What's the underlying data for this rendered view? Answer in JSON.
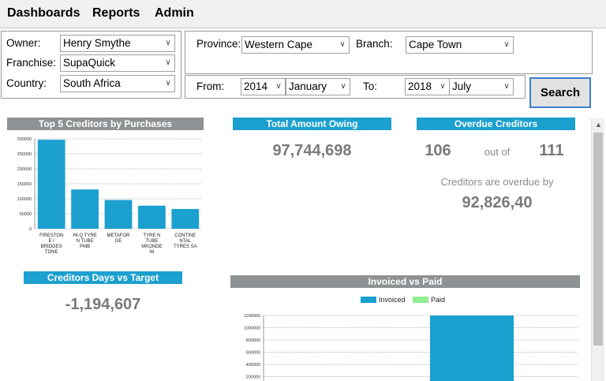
{
  "menu": {
    "items": [
      "Dashboards",
      "Reports",
      "Admin"
    ]
  },
  "filters": {
    "owner_label": "Owner:",
    "owner_value": "Henry Smythe",
    "franchise_label": "Franchise:",
    "franchise_value": "SupaQuick",
    "country_label": "Country:",
    "country_value": "South Africa",
    "province_label": "Province:",
    "province_value": "Western Cape",
    "branch_label": "Branch:",
    "branch_value": "Cape Town",
    "from_label": "From:",
    "from_year": "2014",
    "from_month": "January",
    "to_label": "To:",
    "to_year": "2018",
    "to_month": "July",
    "search_label": "Search"
  },
  "top_creditors": {
    "title": "Top 5 Creditors by Purchases"
  },
  "total_owing": {
    "title": "Total Amount Owing",
    "value": "97,744,698"
  },
  "overdue": {
    "title": "Overdue Creditors",
    "count": "106",
    "out_of": "out of",
    "total": "111",
    "overdue_by_label": "Creditors are overdue by",
    "overdue_by_value": "92,826,40"
  },
  "creditor_days": {
    "title": "Creditors Days vs Target",
    "value": "-1,194,607"
  },
  "invoiced_vs_paid": {
    "title": "Invoiced vs Paid"
  },
  "colors": {
    "accent_blue": "#1ba0cf",
    "title_gray": "#8e9295",
    "paid_green": "#90ee90"
  },
  "chart_data": [
    {
      "type": "bar",
      "title": "Top 5 Creditors by Purchases",
      "categories": [
        "FIRESTON E / BRIDGES TONE",
        "HI-Q TYRE N TUBE PMB",
        "METAFOR GE",
        "TYRE N TUBE MKONDE NI",
        "CONTINE NTAL TYRES SA"
      ],
      "category_lines": [
        [
          "FIRESTON",
          "E /",
          "BRIDGES",
          "TONE"
        ],
        [
          "HI-Q TYRE",
          "N TUBE",
          "PMB"
        ],
        [
          "METAFOR",
          "GE"
        ],
        [
          "TYRE N",
          "TUBE",
          "MKONDE",
          "NI"
        ],
        [
          "CONTINE",
          "NTAL",
          "TYRES SA"
        ]
      ],
      "values": [
        297000,
        131000,
        96000,
        77000,
        66000
      ],
      "ylim": [
        0,
        300000
      ],
      "yticks": [
        0,
        50000,
        100000,
        150000,
        200000,
        250000,
        300000
      ],
      "ytick_labels": [
        "0",
        "50000",
        "100000",
        "150000",
        "200000",
        "250000",
        "300000"
      ],
      "grid": true
    },
    {
      "type": "bar",
      "title": "Invoiced vs Paid",
      "legend": [
        "Invoiced",
        "Paid"
      ],
      "legend_placement": "top",
      "series": [
        {
          "name": "Invoiced",
          "color": "#1ba0cf",
          "values": [
            1200000
          ]
        },
        {
          "name": "Paid",
          "color": "#90ee90",
          "values": []
        }
      ],
      "ylim": [
        0,
        1200000
      ],
      "yticks": [
        200000,
        400000,
        600000,
        800000,
        1000000,
        1200000
      ],
      "ytick_labels": [
        "200000",
        "400000",
        "600000",
        "800000",
        "1000000",
        "1200000"
      ],
      "grid": true
    }
  ]
}
